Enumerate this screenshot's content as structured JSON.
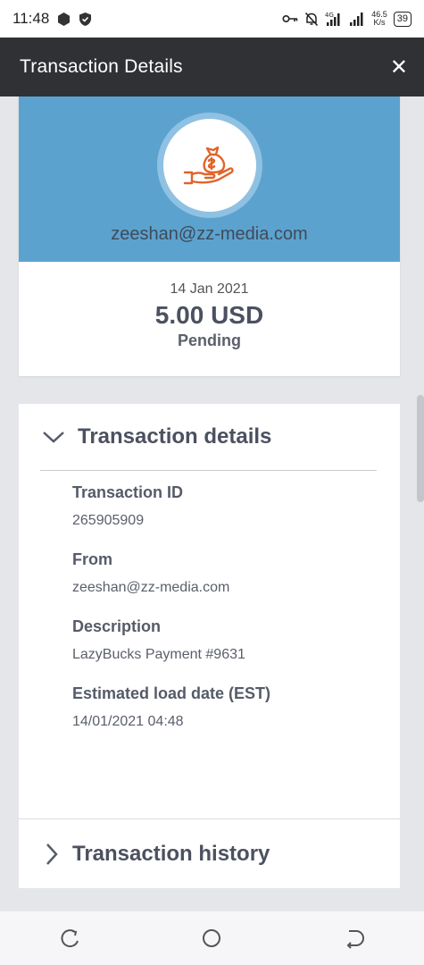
{
  "status_bar": {
    "time": "11:48",
    "network_speed_top": "46.5",
    "network_speed_bottom": "K/s",
    "battery": "39"
  },
  "titlebar": {
    "title": "Transaction Details",
    "close_glyph": "✕"
  },
  "summary": {
    "email": "zeeshan@zz-media.com",
    "date": "14 Jan 2021",
    "amount": "5.00 USD",
    "status": "Pending",
    "icon": "money-bag-hand-icon",
    "accent_color": "#5ca2cf"
  },
  "details": {
    "section_title": "Transaction details",
    "fields": [
      {
        "label": "Transaction ID",
        "value": "265905909"
      },
      {
        "label": "From",
        "value": "zeeshan@zz-media.com"
      },
      {
        "label": "Description",
        "value": "LazyBucks Payment #9631"
      },
      {
        "label": "Estimated load date (EST)",
        "value": "14/01/2021 04:48"
      }
    ]
  },
  "history": {
    "section_title": "Transaction history"
  }
}
